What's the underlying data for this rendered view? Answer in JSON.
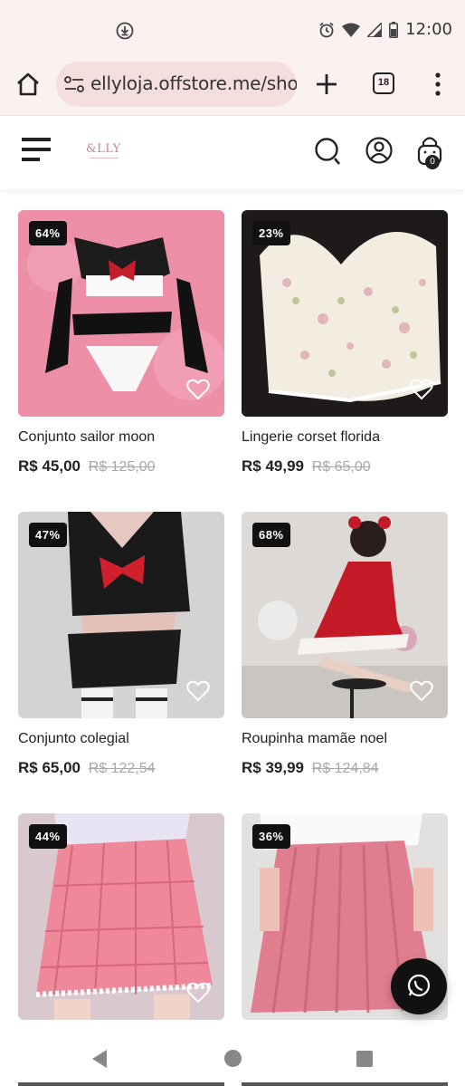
{
  "status_bar": {
    "time": "12:00"
  },
  "browser": {
    "url": "ellyloja.offstore.me/sho",
    "tab_count": "18"
  },
  "site": {
    "logo": "&LLY",
    "cart_count": "0"
  },
  "products": [
    {
      "discount": "64%",
      "name": "Conjunto sailor moon",
      "price": "R$ 45,00",
      "old_price": "R$ 125,00"
    },
    {
      "discount": "23%",
      "name": "Lingerie corset florida",
      "price": "R$ 49,99",
      "old_price": "R$ 65,00"
    },
    {
      "discount": "47%",
      "name": "Conjunto colegial",
      "price": "R$ 65,00",
      "old_price": "R$ 122,54"
    },
    {
      "discount": "68%",
      "name": "Roupinha mamãe noel",
      "price": "R$ 39,99",
      "old_price": "R$ 124,84"
    },
    {
      "discount": "44%",
      "name": "",
      "price": "",
      "old_price": ""
    },
    {
      "discount": "36%",
      "name": "",
      "price": "",
      "old_price": ""
    }
  ],
  "icons": {
    "status": [
      "download-icon",
      "alarm-icon",
      "wifi-icon",
      "signal-icon",
      "battery-icon"
    ],
    "browser": [
      "home-icon",
      "site-settings-icon",
      "plus-icon",
      "tab-switcher-icon",
      "more-vert-icon"
    ],
    "header": [
      "hamburger-menu-icon",
      "search-icon",
      "user-icon",
      "cart-icon"
    ],
    "card": [
      "heart-icon"
    ],
    "floating": [
      "whatsapp-icon"
    ]
  },
  "colors": {
    "browser_bg": "#fcf1f1",
    "url_pill": "#f5dede",
    "badge_bg": "#111111",
    "logo": "#c8839a"
  }
}
